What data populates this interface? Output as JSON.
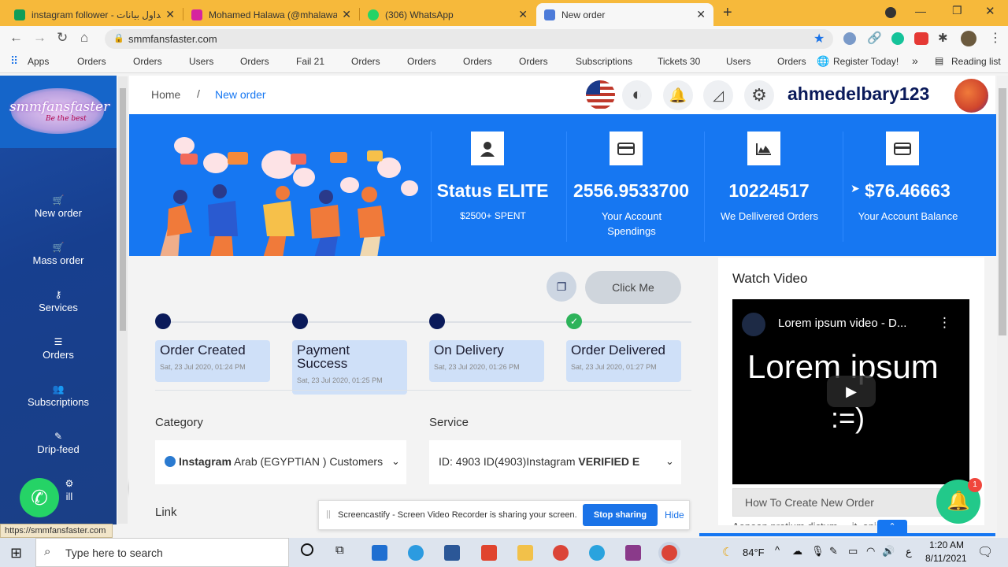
{
  "browser": {
    "tabs": [
      {
        "title": "instagram follower - جداول بيانات",
        "favicon_color": "#0f9d58",
        "active": false
      },
      {
        "title": "Mohamed Halawa (@mhalawaofi",
        "favicon_color": "#d6249f",
        "active": false
      },
      {
        "title": "(306) WhatsApp",
        "favicon_color": "#25d366",
        "active": false
      },
      {
        "title": "New order",
        "favicon_color": "#4c7bd9",
        "active": true
      }
    ],
    "url": "smmfansfaster.com",
    "bookmarks": [
      "Apps",
      "Orders",
      "Orders",
      "Users",
      "Orders",
      "Fail 21",
      "Orders",
      "Orders",
      "Orders",
      "Orders",
      "Subscriptions",
      "Tickets 30",
      "Users",
      "Orders",
      "Register Today!",
      "»",
      "Reading list"
    ],
    "status_url": "https://smmfansfaster.com"
  },
  "sidebar": {
    "logo_text": "smmfansfaster",
    "logo_tagline": "Be the best",
    "items": [
      {
        "label": "New order",
        "icon": "cart-icon"
      },
      {
        "label": "Mass order",
        "icon": "cart-icon"
      },
      {
        "label": "Services",
        "icon": "key-icon"
      },
      {
        "label": "Orders",
        "icon": "list-icon"
      },
      {
        "label": "Subscriptions",
        "icon": "users-icon"
      },
      {
        "label": "Drip-feed",
        "icon": "dropper-icon"
      },
      {
        "label": "ill",
        "icon": "gear-icon"
      }
    ]
  },
  "header": {
    "breadcrumb_home": "Home",
    "breadcrumb_sep": "/",
    "breadcrumb_current": "New order",
    "username": "ahmedelbary123"
  },
  "stats": [
    {
      "value": "Status ELITE",
      "label": "$2500+ SPENT",
      "icon": "user-icon"
    },
    {
      "value": "2556.9533700",
      "label": "Your Account Spendings",
      "icon": "card-icon"
    },
    {
      "value": "10224517",
      "label": "We Dellivered Orders",
      "icon": "chart-icon"
    },
    {
      "value": "$76.46663",
      "label": "Your Account Balance",
      "icon": "wallet-icon"
    }
  ],
  "click_me": "Click Me",
  "steps": [
    {
      "title": "Order Created",
      "date": "Sat, 23 Jul 2020, 01:24 PM",
      "done": false
    },
    {
      "title": "Payment Success",
      "date": "Sat, 23 Jul 2020, 01:25 PM",
      "done": false
    },
    {
      "title": "On Delivery",
      "date": "Sat, 23 Jul 2020, 01:26 PM",
      "done": false
    },
    {
      "title": "Order Delivered",
      "date": "Sat, 23 Jul 2020, 01:27 PM",
      "done": true
    }
  ],
  "form": {
    "category_label": "Category",
    "category_value_bold": "Instagram",
    "category_value": " Arab (EGYPTIAN ) Customers",
    "service_label": "Service",
    "service_value": "ID: 4903 ID(4903)Instagram ",
    "service_value_bold": "VERIFIED E",
    "link_label": "Link"
  },
  "video": {
    "panel_title": "Watch Video",
    "video_title": "Lorem ipsum video - D...",
    "big_text": "Lorem ipsum",
    "smiley": ":=)",
    "faq_item": "How To Create New Order",
    "faq_next": "Aenean pretium dictum ... it, enim"
  },
  "screencast": {
    "message": "Screencastify - Screen Video Recorder is sharing your screen.",
    "stop": "Stop sharing",
    "hide": "Hide"
  },
  "notification_count": "1",
  "taskbar": {
    "search_placeholder": "Type here to search",
    "temperature": "84°F",
    "lang": "ع",
    "time": "1:20 AM",
    "date": "8/11/2021"
  }
}
